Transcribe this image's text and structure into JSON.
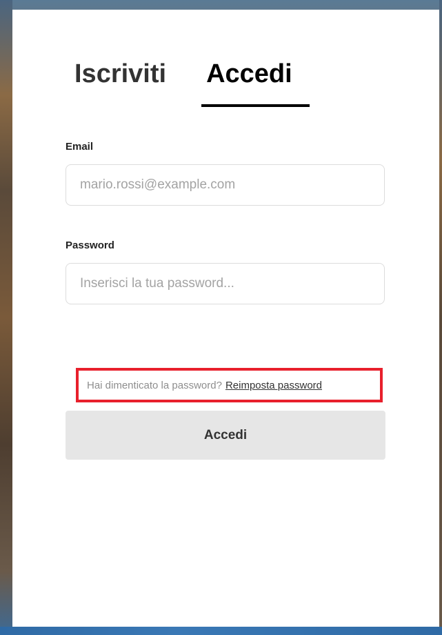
{
  "tabs": {
    "signup_label": "Iscriviti",
    "login_label": "Accedi",
    "active": "login"
  },
  "form": {
    "email": {
      "label": "Email",
      "value": "",
      "placeholder": "mario.rossi@example.com"
    },
    "password": {
      "label": "Password",
      "value": "",
      "placeholder": "Inserisci la tua password..."
    },
    "forgot": {
      "prompt": "Hai dimenticato la password?",
      "link_label": "Reimposta password",
      "highlight_color": "#e8202c"
    },
    "submit_label": "Accedi"
  },
  "colors": {
    "card_background": "#ffffff",
    "button_background": "#e6e6e6",
    "active_tab_underline": "#000000"
  }
}
